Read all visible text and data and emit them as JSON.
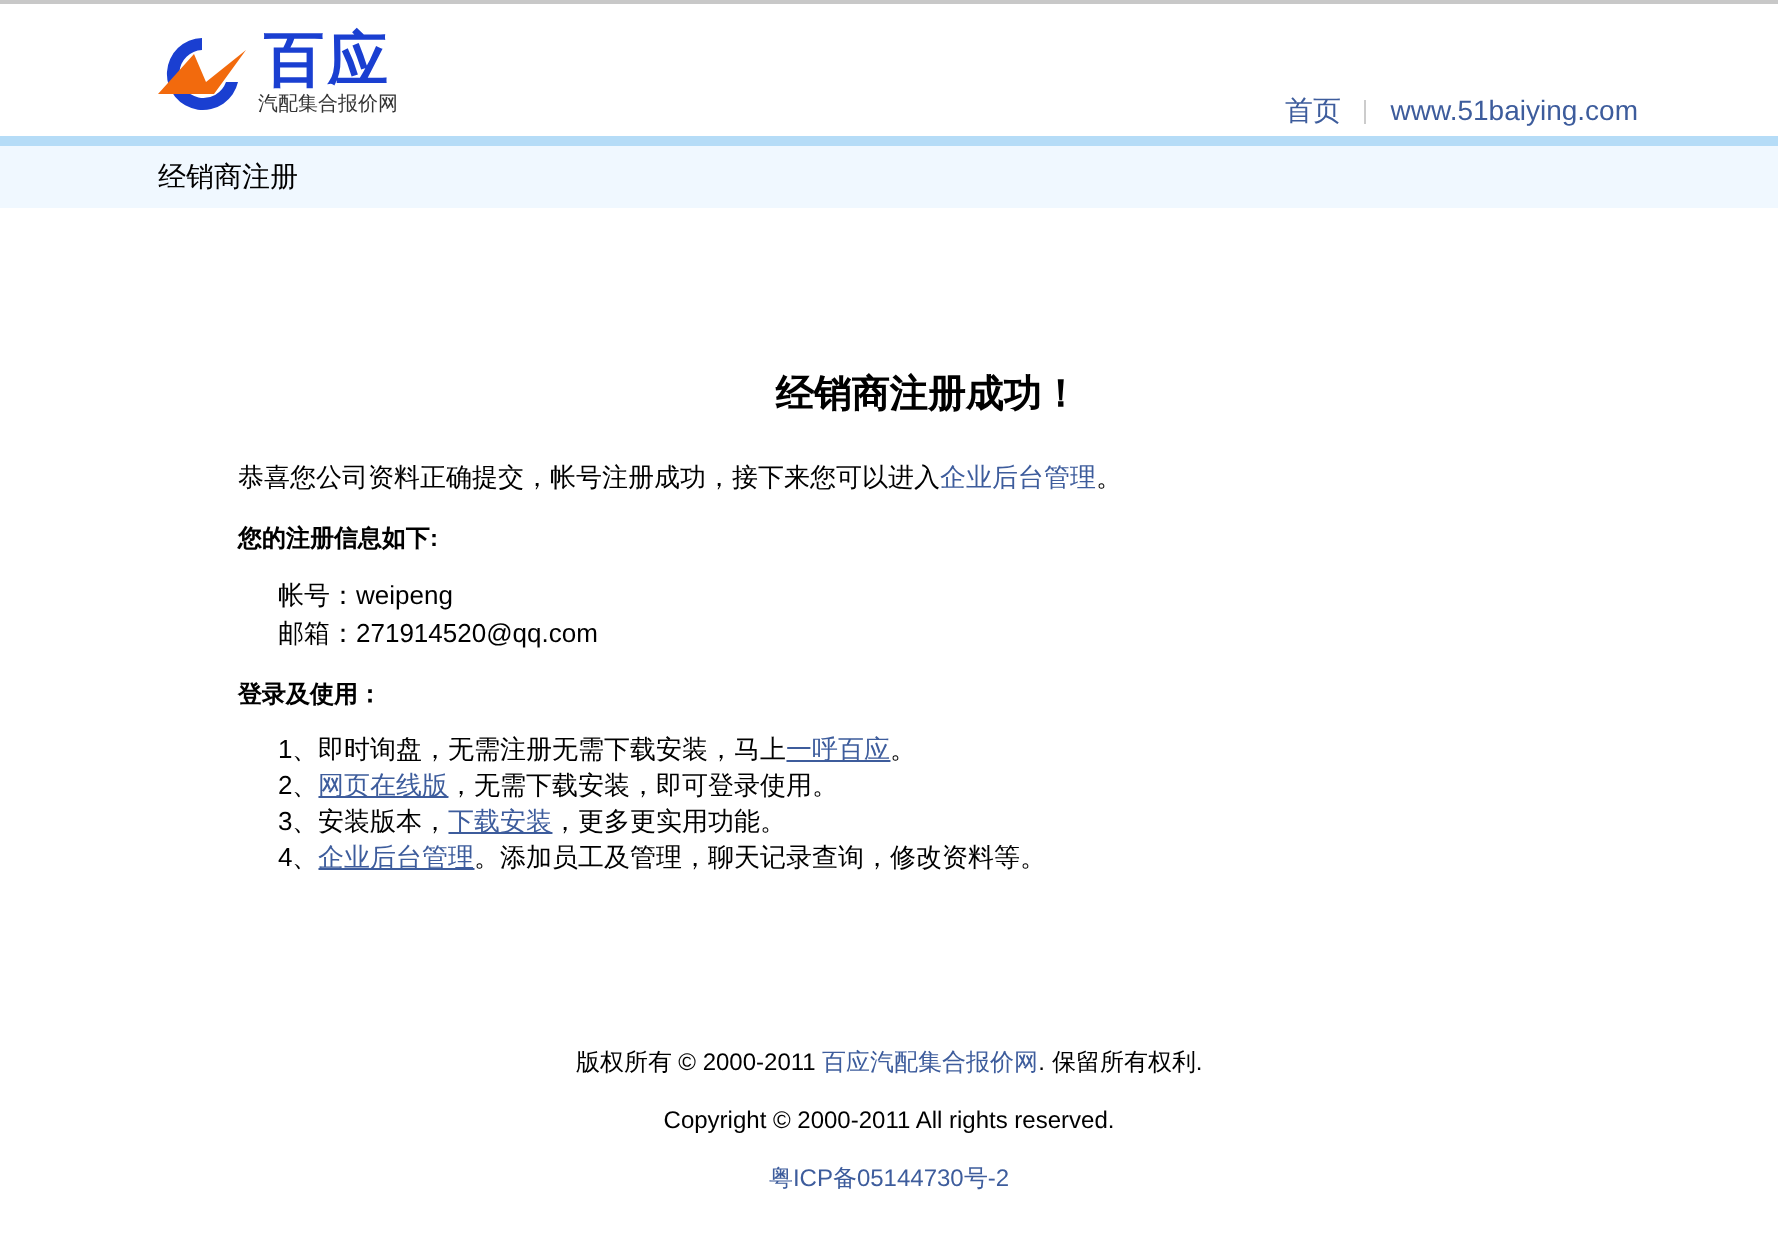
{
  "logo": {
    "name": "百应",
    "tagline": "汽配集合报价网"
  },
  "nav": [
    {
      "label": "首页"
    },
    {
      "label": "www.51baiying.com"
    }
  ],
  "breadcrumb": "经销商注册",
  "title": "经销商注册成功！",
  "intro": [
    {
      "kind": "text",
      "text": "恭喜您公司资料正确提交，帐号注册成功，接下来您可以进入"
    },
    {
      "kind": "link",
      "text": "企业后台管理"
    },
    {
      "kind": "text",
      "text": "。"
    }
  ],
  "info_heading": "您的注册信息如下:",
  "info": [
    {
      "label": "帐号：",
      "value": "weipeng"
    },
    {
      "label": "邮箱：",
      "value": "271914520@qq.com"
    }
  ],
  "usage_heading": "登录及使用：",
  "usage": [
    [
      {
        "kind": "text",
        "text": "1、即时询盘，无需注册无需下载安装，马上"
      },
      {
        "kind": "link",
        "text": "一呼百应"
      },
      {
        "kind": "text",
        "text": "。"
      }
    ],
    [
      {
        "kind": "text",
        "text": "2、"
      },
      {
        "kind": "link",
        "text": "网页在线版"
      },
      {
        "kind": "text",
        "text": "，无需下载安装，即可登录使用。"
      }
    ],
    [
      {
        "kind": "text",
        "text": "3、安装版本，"
      },
      {
        "kind": "link",
        "text": "下载安装"
      },
      {
        "kind": "text",
        "text": "，更多更实用功能。"
      }
    ],
    [
      {
        "kind": "text",
        "text": "4、"
      },
      {
        "kind": "link",
        "text": "企业后台管理"
      },
      {
        "kind": "text",
        "text": "。添加员工及管理，聊天记录查询，修改资料等。"
      }
    ]
  ],
  "footer": {
    "rights": [
      {
        "kind": "text",
        "text": "版权所有 © 2000-2011 "
      },
      {
        "kind": "link",
        "text": "百应汽配集合报价网"
      },
      {
        "kind": "text",
        "text": ". 保留所有权利."
      }
    ],
    "copyright": "Copyright © 2000-2011 All rights reserved.",
    "icp": "粤ICP备05144730号-2"
  }
}
